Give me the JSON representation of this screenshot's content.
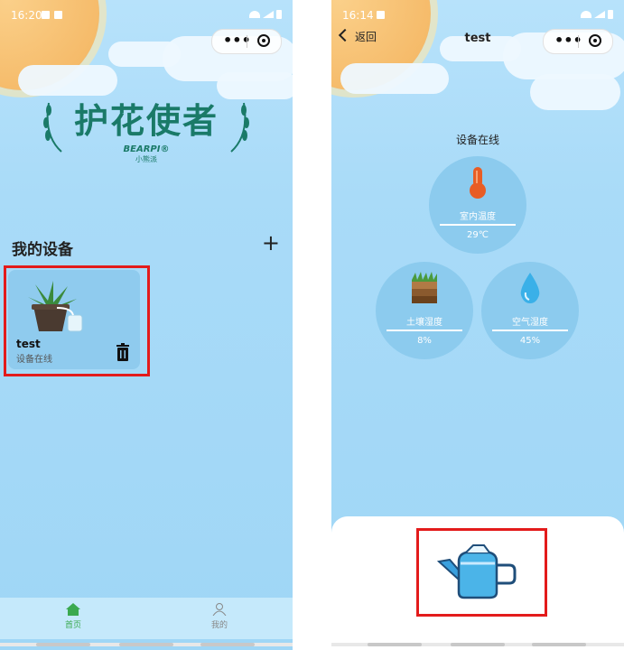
{
  "left": {
    "status_time": "16:20",
    "app_logo_text": "护花使者",
    "brand": "BEARPI®",
    "brand_sub": "小熊派",
    "section_title": "我的设备",
    "add_label": "+",
    "device": {
      "name": "test",
      "status": "设备在线"
    },
    "tabs": [
      {
        "label": "首页",
        "icon": "home-icon",
        "active": true
      },
      {
        "label": "我的",
        "icon": "user-icon",
        "active": false
      }
    ]
  },
  "right": {
    "status_time": "16:14",
    "back_label": "返回",
    "title": "test",
    "online_text": "设备在线",
    "gauges": [
      {
        "label": "室内温度",
        "value": "29℃",
        "icon": "thermometer-icon"
      },
      {
        "label": "土壤湿度",
        "value": "8%",
        "icon": "soil-icon"
      },
      {
        "label": "空气湿度",
        "value": "45%",
        "icon": "water-drop-icon"
      }
    ],
    "action_icon": "watering-can-icon"
  },
  "colors": {
    "accent_green": "#3aa94f",
    "logo_green": "#1a7a68",
    "highlight_red": "#e31b1b",
    "sky": "#a9dbf8"
  }
}
